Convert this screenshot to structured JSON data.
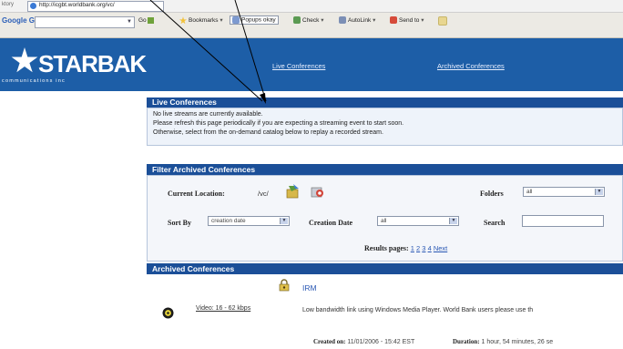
{
  "browser": {
    "address_url": "http://icgbt.worldbank.org/vc/",
    "search_engine_label": "Google G",
    "go_label": "Go",
    "bookmarks_label": "Bookmarks",
    "popups_label": "Popups okay",
    "check_label": "Check",
    "autolink_label": "AutoLink",
    "sendto_label": "Send to"
  },
  "header": {
    "logo_text": "STARBAK",
    "logo_subtitle": "communications inc",
    "nav": [
      "Live Conferences",
      "Archived Conferences"
    ]
  },
  "live": {
    "title": "Live Conferences",
    "lines": [
      "No live streams are currently available.",
      "Please refresh this page periodically if you are expecting a streaming event to start soon.",
      "Otherwise, select from the on-demand catalog below to replay a recorded stream."
    ]
  },
  "filter": {
    "title": "Filter Archived Conferences",
    "current_location_label": "Current Location:",
    "current_location_value": "/vc/",
    "folders_label": "Folders",
    "folders_value": "all",
    "sort_by_label": "Sort By",
    "sort_by_value": "creation date",
    "creation_date_label": "Creation Date",
    "creation_date_value": "all",
    "search_label": "Search",
    "search_value": "",
    "results_label": "Results pages:",
    "pages": [
      "1",
      "2",
      "3",
      "4"
    ],
    "next_label": "Next"
  },
  "archived": {
    "title": "Archived Conferences",
    "item": {
      "name": "IRM",
      "video_link": "Video: 16 - 62 kbps",
      "description": "Low bandwidth link using Windows Media Player. World Bank users please use th",
      "created_label": "Created on:",
      "created_value": "11/01/2006 - 15:42 EST",
      "duration_label": "Duration:",
      "duration_value": "1 hour, 54 minutes, 26 se"
    }
  },
  "colors": {
    "header_blue": "#1d5ea7",
    "panel_head": "#1b4f98",
    "panel_body": "#eef3fa"
  }
}
